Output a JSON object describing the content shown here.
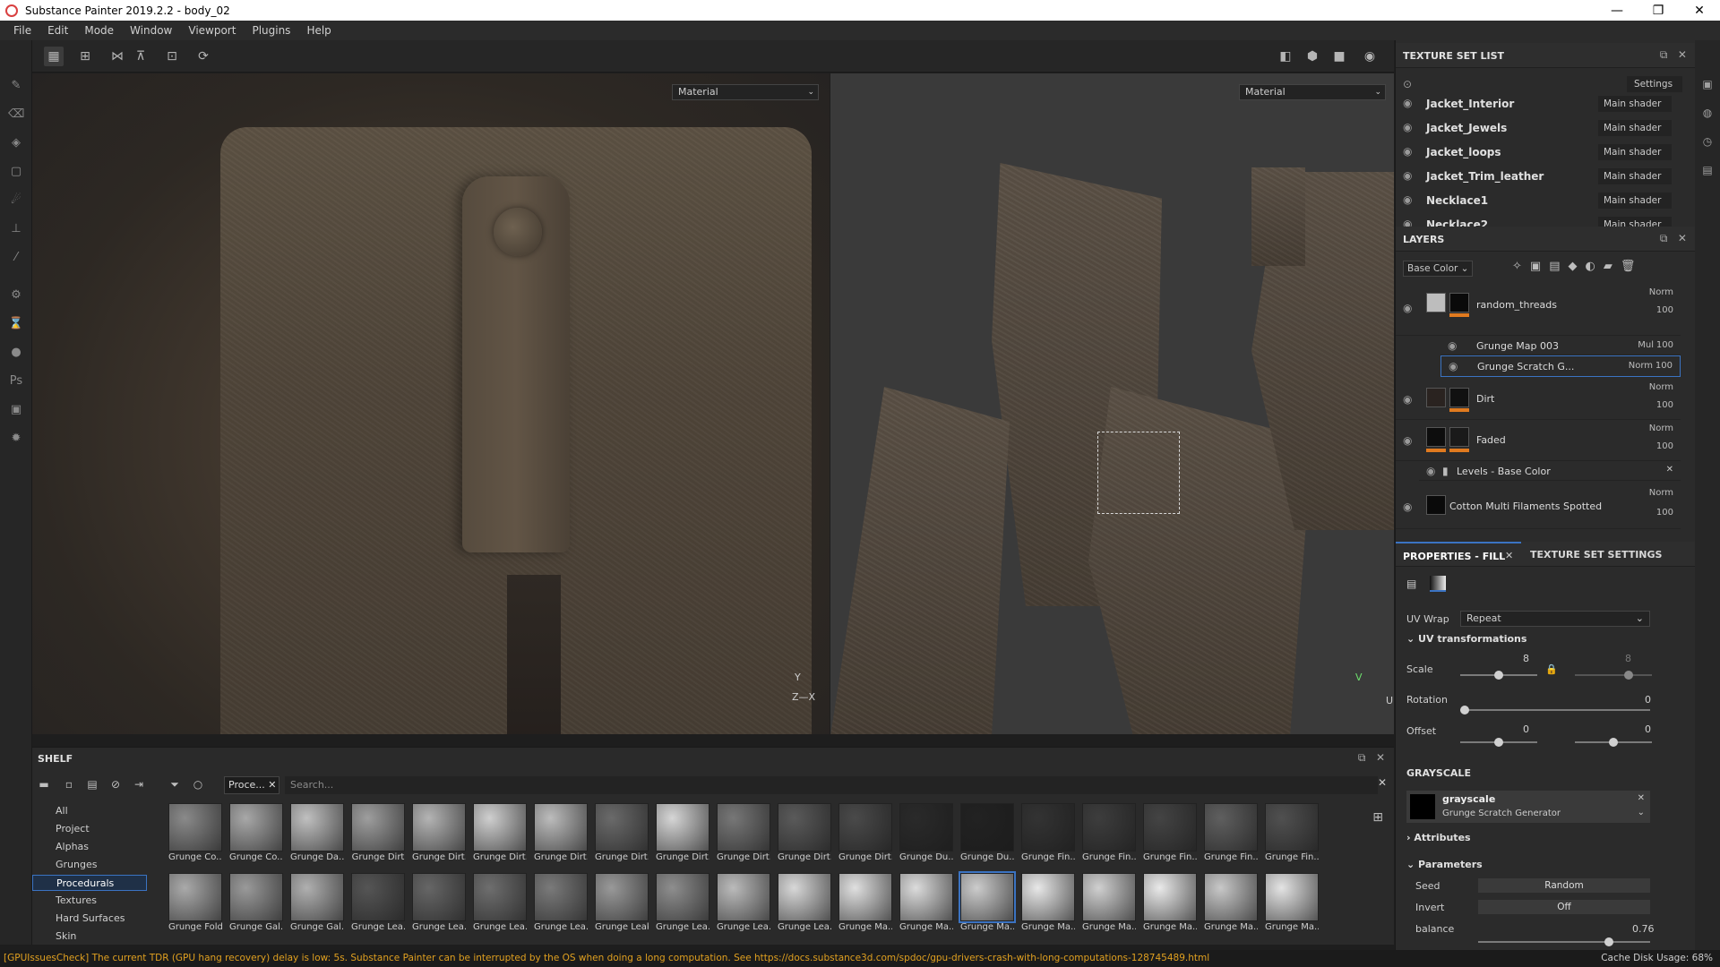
{
  "window": {
    "title": "Substance Painter 2019.2.2 - body_02",
    "minimize": "—",
    "restore": "❐",
    "close": "✕"
  },
  "menu": [
    "File",
    "Edit",
    "Mode",
    "Window",
    "Viewport",
    "Plugins",
    "Help"
  ],
  "viewport": {
    "left_mode": "Material",
    "right_mode": "Material",
    "axis3d_y": "Y",
    "axis3d_x": "Z—X",
    "axis2d_v": "V",
    "axis2d_u": "U"
  },
  "texture_set_list": {
    "title": "TEXTURE SET LIST",
    "settings_label": "Settings",
    "items": [
      {
        "name": "Jacket_Interior",
        "shader": "Main shader"
      },
      {
        "name": "Jacket_Jewels",
        "shader": "Main shader"
      },
      {
        "name": "Jacket_loops",
        "shader": "Main shader"
      },
      {
        "name": "Jacket_Trim_leather",
        "shader": "Main shader"
      },
      {
        "name": "Necklace1",
        "shader": "Main shader"
      },
      {
        "name": "Necklace2",
        "shader": "Main shader"
      }
    ]
  },
  "layers": {
    "title": "LAYERS",
    "channel": "Base Color",
    "rows": [
      {
        "name": "random_threads",
        "blend": "Norm",
        "opacity": "100"
      },
      {
        "name": "Grunge Map 003",
        "blend": "Mul",
        "opacity": "100"
      },
      {
        "name": "Grunge Scratch G...",
        "blend": "Norm",
        "opacity": "100"
      },
      {
        "name": "Dirt",
        "blend": "Norm",
        "opacity": "100"
      },
      {
        "name": "Faded",
        "blend": "Norm",
        "opacity": "100"
      },
      {
        "name": "Levels - Base Color",
        "blend": "",
        "opacity": ""
      },
      {
        "name": "Cotton Multi Filaments Spotted",
        "blend": "Norm",
        "opacity": "100"
      }
    ]
  },
  "properties": {
    "tab_fill": "PROPERTIES - FILL",
    "tab_settings": "TEXTURE SET SETTINGS",
    "uv_wrap_label": "UV Wrap",
    "uv_wrap_value": "Repeat",
    "uv_transform_label": "UV transformations",
    "scale_label": "Scale",
    "scale_value": "8",
    "scale_value2": "8",
    "scale_fraction": 0.32,
    "rotation_label": "Rotation",
    "rotation_value": "0",
    "offset_label": "Offset",
    "offset_value1": "0",
    "offset_value2": "0",
    "grayscale_section": "GRAYSCALE",
    "grayscale_name": "grayscale",
    "grayscale_source": "Grunge Scratch Generator",
    "attributes_label": "Attributes",
    "parameters_label": "Parameters",
    "seed_label": "Seed",
    "seed_value": "Random",
    "invert_label": "Invert",
    "invert_value": "Off",
    "balance_label": "balance",
    "balance_value": "0.76",
    "balance_fraction": 0.76
  },
  "shelf": {
    "title": "SHELF",
    "filter_tag": "Proce...",
    "search_placeholder": "Search...",
    "categories": [
      "All",
      "Project",
      "Alphas",
      "Grunges",
      "Procedurals",
      "Textures",
      "Hard Surfaces",
      "Skin"
    ],
    "selected_category": "Procedurals",
    "row1": [
      "Grunge Co...",
      "Grunge Co...",
      "Grunge Da...",
      "Grunge Dirt",
      "Grunge Dirt...",
      "Grunge Dirt...",
      "Grunge Dirt...",
      "Grunge Dirt...",
      "Grunge Dirt...",
      "Grunge Dirt...",
      "Grunge Dirt...",
      "Grunge Dirt...",
      "Grunge Du...",
      "Grunge Du...",
      "Grunge Fin...",
      "Grunge Fin...",
      "Grunge Fin...",
      "Grunge Fin...",
      "Grunge Fin..."
    ],
    "row2": [
      "Grunge Folds",
      "Grunge Gal...",
      "Grunge Gal...",
      "Grunge Lea...",
      "Grunge Lea...",
      "Grunge Lea...",
      "Grunge Lea...",
      "Grunge Leaks",
      "Grunge Lea...",
      "Grunge Lea...",
      "Grunge Lea...",
      "Grunge Ma...",
      "Grunge Ma...",
      "Grunge Ma...",
      "Grunge Ma...",
      "Grunge Ma...",
      "Grunge Ma...",
      "Grunge Ma...",
      "Grunge Ma..."
    ]
  },
  "status": {
    "warning": "[GPUIssuesCheck] The current TDR (GPU hang recovery) delay is low: 5s. Substance Painter can be interrupted by the OS when doing a long computation. See https://docs.substance3d.com/spdoc/gpu-drivers-crash-with-long-computations-128745489.html",
    "cache": "Cache Disk Usage:    68%"
  }
}
